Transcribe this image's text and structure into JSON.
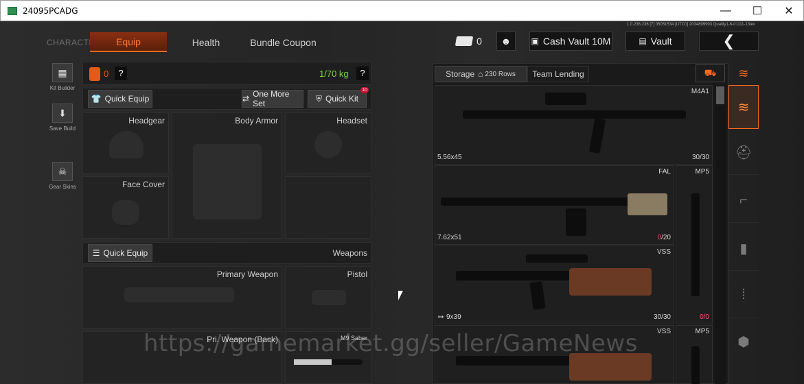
{
  "window": {
    "title": "24095PCADG",
    "minimize": "—",
    "maximize": "☐",
    "close": "✕"
  },
  "nav": {
    "character": "CHARACTER",
    "tabs": [
      "Equip",
      "Health",
      "Bundle Coupon"
    ],
    "active_tab": "Equip",
    "accent": "#ff6a1a"
  },
  "topbar": {
    "ticket_count": "0",
    "cash_vault": "Cash Vault 10M",
    "vault": "Vault",
    "info_text": "1.0.236.236 [7] 05051534 [UTC0] 2034899993 Quality1-6-01111-13lev"
  },
  "rail": {
    "kit_builder": "Kit Builder",
    "save_build": "Save Build",
    "gear_skins": "Gear Skins"
  },
  "equip": {
    "bag_count": "0",
    "weight": "1/70 kg",
    "weight_color": "#7bd23a",
    "help": "?",
    "quick_equip": "Quick Equip",
    "one_more_set": "One More Set",
    "quick_kit": "Quick Kit",
    "quick_kit_badge": "10",
    "slots": {
      "headgear": "Headgear",
      "body_armor": "Body Armor",
      "headset": "Headset",
      "face_cover": "Face Cover"
    },
    "weapons_quick_equip": "Quick Equip",
    "weapons_label": "Weapons",
    "primary_weapon": "Primary Weapon",
    "pistol": "Pistol",
    "primary_back": "Pri. Weapon (Back)",
    "melee": "M9 Saber"
  },
  "storage": {
    "tab_storage": "Storage",
    "rows": "230 Rows",
    "tab_team": "Team Lending",
    "items": [
      {
        "name": "M4A1",
        "ammo": "5.56x45",
        "count": "30/30"
      },
      {
        "name": "FAL",
        "ammo": "7.62x51",
        "count_red": "0",
        "count_rest": "/20"
      },
      {
        "name": "MP5",
        "ammo": "",
        "count": ""
      },
      {
        "name": "VSS",
        "ammo": "9x39",
        "count": "30/30"
      },
      {
        "name": "VSS",
        "ammo": "",
        "count": ""
      },
      {
        "name": "MP5",
        "ammo": "",
        "count": ""
      }
    ],
    "side_count_red": "0",
    "side_count_rest": "/0"
  },
  "watermark": "https://gamemarket.gg/seller/GameNews"
}
